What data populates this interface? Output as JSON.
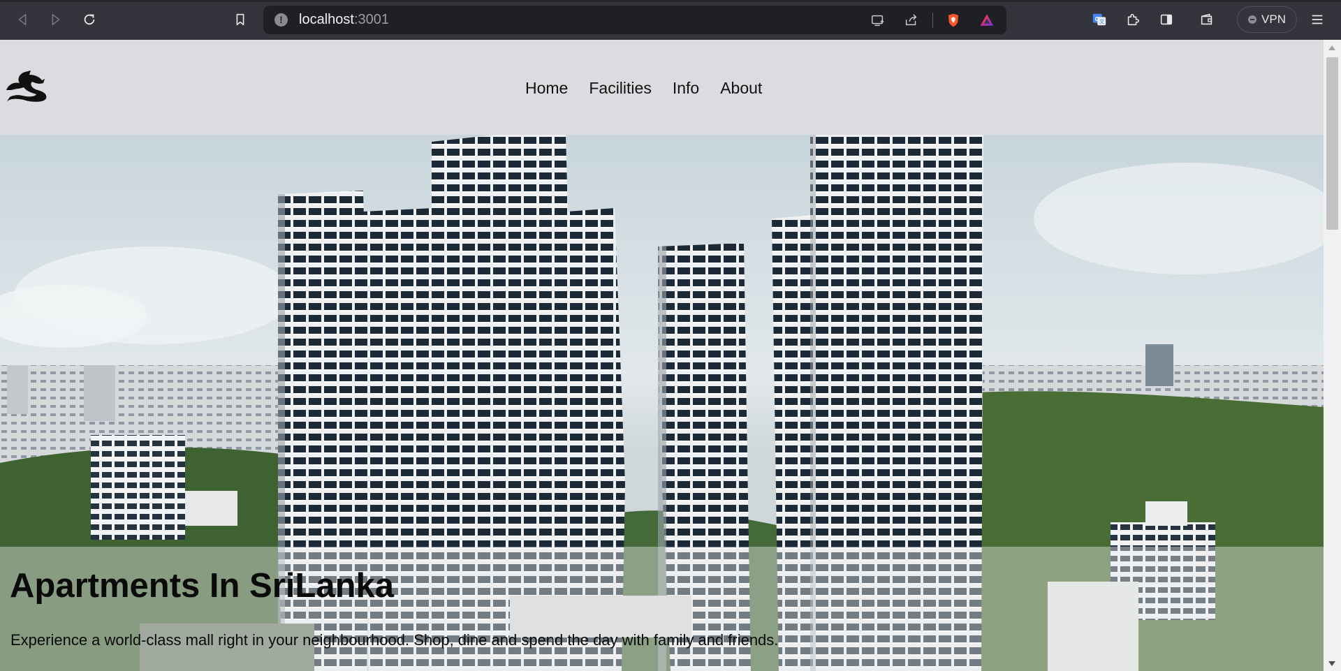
{
  "browser": {
    "url_host": "localhost",
    "url_port": ":3001",
    "vpn_label": "VPN",
    "colors": {
      "chrome_bg": "#33343c",
      "urlbar_bg": "#1f2026",
      "brave_orange": "#fb542b"
    }
  },
  "site": {
    "nav": [
      {
        "label": "Home"
      },
      {
        "label": "Facilities"
      },
      {
        "label": "Info"
      },
      {
        "label": "About"
      }
    ],
    "hero": {
      "title": "Apartments In SriLanka",
      "description": "Experience a world-class mall right in your neighbourhood. Shop, dine and spend the day with family and friends."
    },
    "colors": {
      "header_bg": "#dcdce0",
      "text": "#111111"
    }
  }
}
